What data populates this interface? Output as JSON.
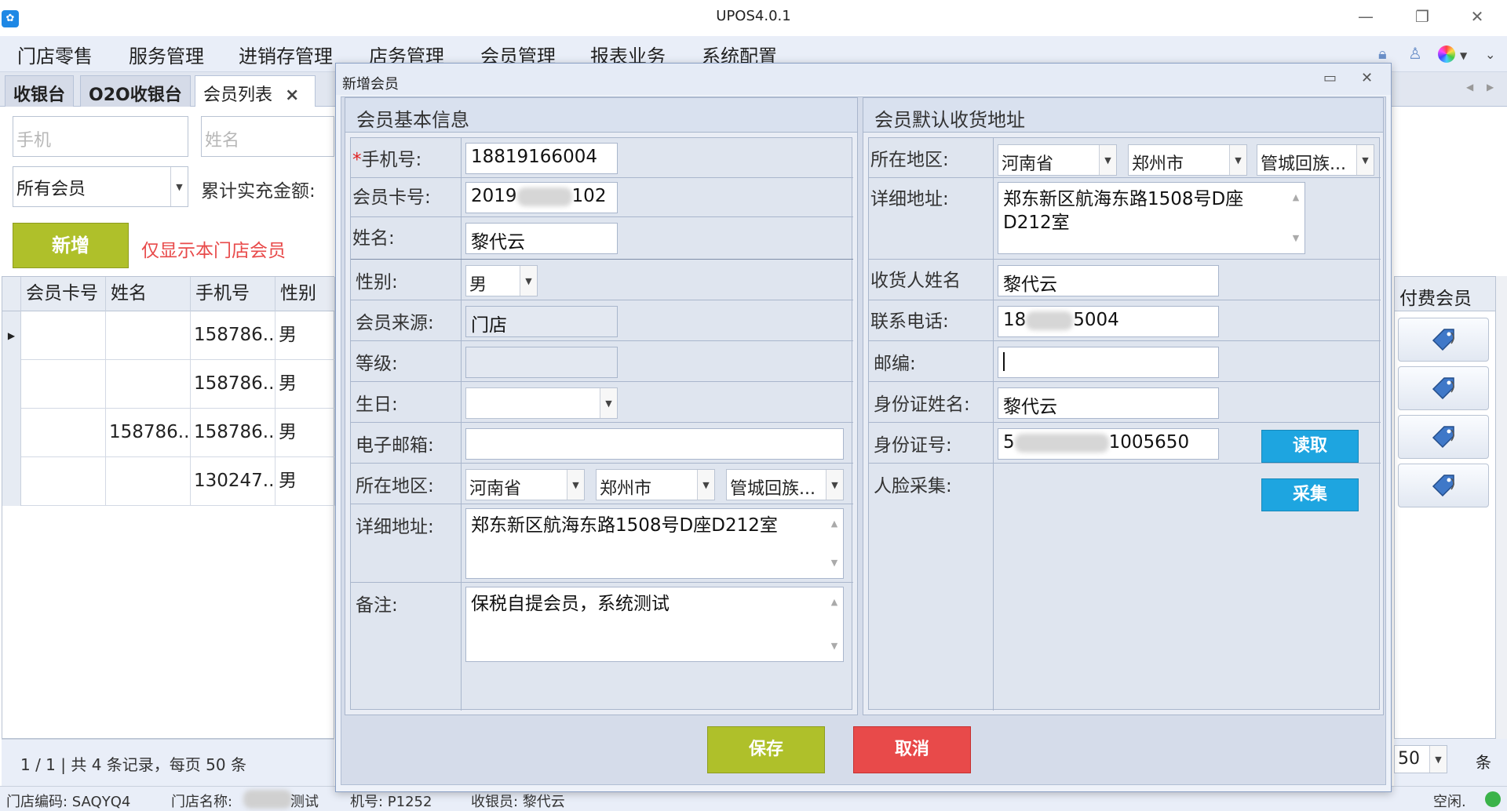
{
  "window": {
    "title": "UPOS4.0.1",
    "minimize": "—",
    "restore": "❐",
    "close": "✕"
  },
  "menu": [
    "门店零售",
    "服务管理",
    "进销存管理",
    "店务管理",
    "会员管理",
    "报表业务",
    "系统配置"
  ],
  "tabs": {
    "items": [
      "收银台",
      "O2O收银台",
      "会员列表"
    ],
    "close": "×"
  },
  "left_panel": {
    "phone_placeholder": "手机",
    "name_placeholder": "姓名",
    "member_filter": "所有会员",
    "recharge_label": "累计实充金额:",
    "add_button": "新增",
    "store_only": "仅显示本门店会员"
  },
  "grid": {
    "headers": [
      "会员卡号",
      "姓名",
      "手机号",
      "性别"
    ],
    "rows": [
      {
        "card": "",
        "name": "",
        "phone": "158786...",
        "gender": "男"
      },
      {
        "card": "",
        "name": "",
        "phone": "158786...",
        "gender": "男"
      },
      {
        "card": "",
        "name": "158786...",
        "phone": "158786...",
        "gender": "男"
      },
      {
        "card": "",
        "name": "",
        "phone": "130247...",
        "gender": "男"
      }
    ],
    "pager_text": "1 / 1 | 共 4 条记录，每页 50 条",
    "page_size": "50",
    "page_unit": "条",
    "paid_member_header": "付费会员"
  },
  "status": {
    "store_code": "门店编码:  SAQYQ4",
    "store_name_prefix": "门店名称:",
    "store_name_suffix": "测试",
    "machine": "机号:  P1252",
    "cashier": "收银员:  黎代云",
    "idle": "空闲."
  },
  "dialog": {
    "title": "新增会员",
    "min": "▭",
    "close": "✕",
    "basic": {
      "header": "会员基本信息",
      "required_mark": "*",
      "labels": {
        "phone": "手机号:",
        "card": "会员卡号:",
        "name": "姓名:",
        "gender": "性别:",
        "source": "会员来源:",
        "level": "等级:",
        "birthday": "生日:",
        "email": "电子邮箱:",
        "region": "所在地区:",
        "address": "详细地址:",
        "remark": "备注:"
      },
      "values": {
        "phone": "18819166004",
        "card_prefix": "2019",
        "card_suffix": "102",
        "name": "黎代云",
        "gender": "男",
        "source": "门店",
        "level": "",
        "birthday": "",
        "email": "",
        "province": "河南省",
        "city": "郑州市",
        "district": "管城回族...",
        "address": "郑东新区航海东路1508号D座D212室",
        "remark": "保税自提会员，系统测试"
      }
    },
    "shipping": {
      "header": "会员默认收货地址",
      "labels": {
        "region": "所在地区:",
        "address": "详细地址:",
        "receiver": "收货人姓名",
        "phone": "联系电话:",
        "zip": "邮编:",
        "id_name": "身份证姓名:",
        "id_no": "身份证号:",
        "face": "人脸采集:"
      },
      "values": {
        "province": "河南省",
        "city": "郑州市",
        "district": "管城回族...",
        "address": "郑东新区航海东路1508号D座D212室",
        "receiver": "黎代云",
        "phone_prefix": "18",
        "phone_suffix": "5004",
        "zip": "",
        "id_name": "黎代云",
        "id_prefix": "5",
        "id_suffix": "1005650"
      },
      "read_button": "读取",
      "capture_button": "采集"
    },
    "save_button": "保存",
    "cancel_button": "取消"
  },
  "colors": {
    "accent_green": "#afc02a",
    "cancel_red": "#e84a4a",
    "action_blue": "#1ea5e0",
    "warning_text": "#e84a4a"
  }
}
